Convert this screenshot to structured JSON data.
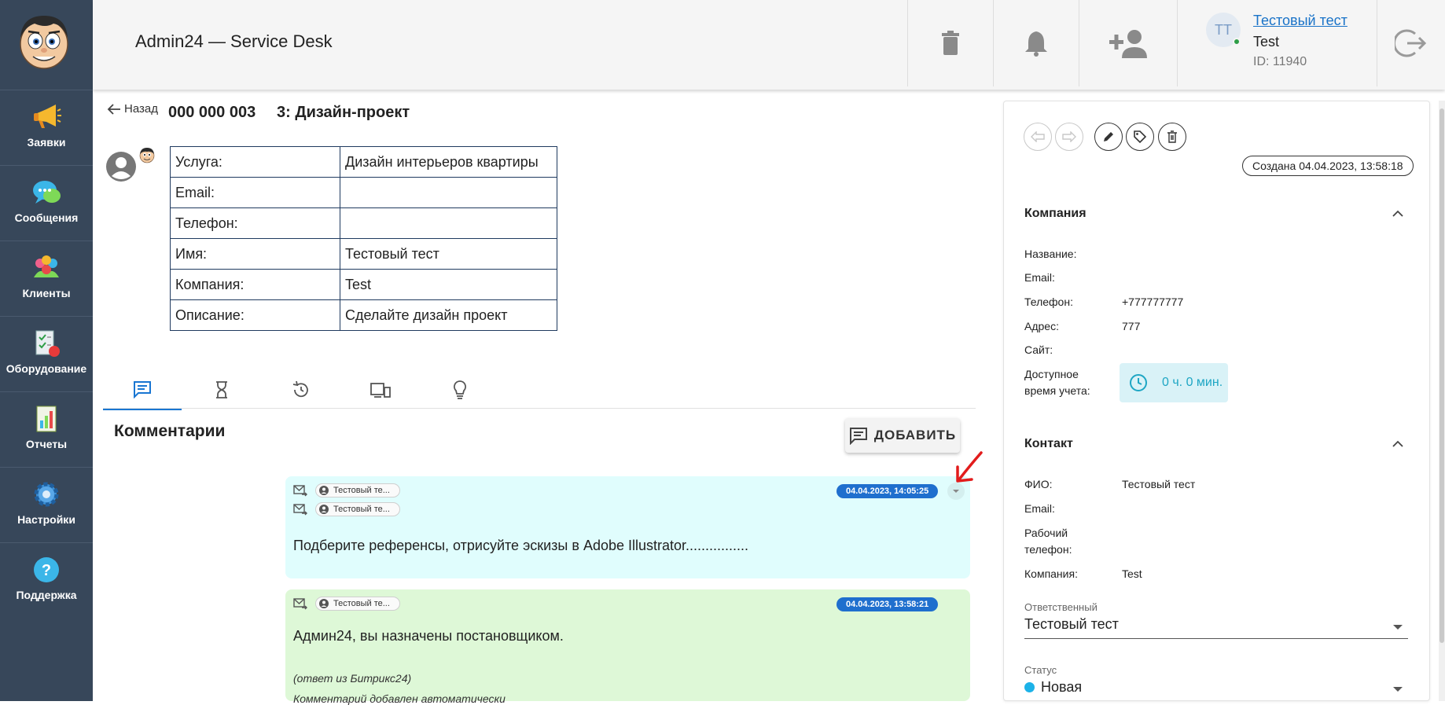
{
  "sidebar": {
    "items": [
      {
        "label": "Заявки",
        "icon": "megaphone-icon"
      },
      {
        "label": "Сообщения",
        "icon": "chat-bubbles-icon"
      },
      {
        "label": "Клиенты",
        "icon": "people-icon"
      },
      {
        "label": "Оборудование",
        "icon": "equipment-checklist-icon"
      },
      {
        "label": "Отчеты",
        "icon": "report-chart-icon"
      },
      {
        "label": "Настройки",
        "icon": "gear-icon"
      },
      {
        "label": "Поддержка",
        "icon": "help-icon"
      }
    ]
  },
  "header": {
    "title": "Admin24 — Service Desk",
    "user": {
      "initials": "TT",
      "name": "Тестовый тест",
      "company": "Test",
      "id_text": "ID: 11940"
    }
  },
  "ticket": {
    "back_label": "Назад",
    "number": "000 000 003",
    "title": "3: Дизайн-проект",
    "fields": [
      {
        "key": "Услуга:",
        "value": "Дизайн интерьеров квартиры"
      },
      {
        "key": "Email:",
        "value": ""
      },
      {
        "key": "Телефон:",
        "value": ""
      },
      {
        "key": "Имя:",
        "value": "Тестовый тест"
      },
      {
        "key": "Компания:",
        "value": "Test"
      },
      {
        "key": "Описание:",
        "value": "Сделайте дизайн проект"
      }
    ]
  },
  "tabs": [
    {
      "icon": "comments-icon",
      "active": true
    },
    {
      "icon": "hourglass-icon",
      "active": false
    },
    {
      "icon": "history-icon",
      "active": false
    },
    {
      "icon": "devices-icon",
      "active": false
    },
    {
      "icon": "lightbulb-icon",
      "active": false
    }
  ],
  "comments": {
    "title": "Комментарии",
    "add_label": "ДОБАВИТЬ",
    "items": [
      {
        "recipients": [
          "Тестовый те...",
          "Тестовый те..."
        ],
        "date": "04.04.2023, 14:05:25",
        "text": "Подберите референсы, отрисуйте эскизы в Adobe Illustrator................",
        "bg": "#e0fdfd"
      },
      {
        "recipients": [
          "Тестовый те..."
        ],
        "date": "04.04.2023, 13:58:21",
        "text": "Админ24, вы назначены постановщиком.",
        "note1": "(ответ из Битрикс24)",
        "note2": "Комментарий добавлен автоматически",
        "bg": "#def8d7"
      }
    ]
  },
  "panel": {
    "created": "Создана 04.04.2023, 13:58:18",
    "company": {
      "title": "Компания",
      "fields": [
        {
          "key": "Название:",
          "value": ""
        },
        {
          "key": "Email:",
          "value": ""
        },
        {
          "key": "Телефон:",
          "value": "+777777777"
        },
        {
          "key": "Адрес:",
          "value": "777"
        },
        {
          "key": "Сайт:",
          "value": ""
        }
      ],
      "time_label_1": "Доступное",
      "time_label_2": "время учета:",
      "time_value": "0 ч. 0 мин."
    },
    "contact": {
      "title": "Контакт",
      "fields": [
        {
          "key": "ФИО:",
          "value": "Тестовый тест"
        },
        {
          "key": "Email:",
          "value": ""
        },
        {
          "key": "Рабочий телефон:",
          "value": ""
        },
        {
          "key": "Компания:",
          "value": "Test"
        }
      ]
    },
    "responsible": {
      "label": "Ответственный",
      "value": "Тестовый тест"
    },
    "status": {
      "label": "Статус",
      "value": "Новая",
      "color": "#1cb2e8"
    }
  },
  "colors": {
    "sidebar": "#37475a",
    "accent": "#1976d2",
    "date_badge": "#1f6fce"
  }
}
